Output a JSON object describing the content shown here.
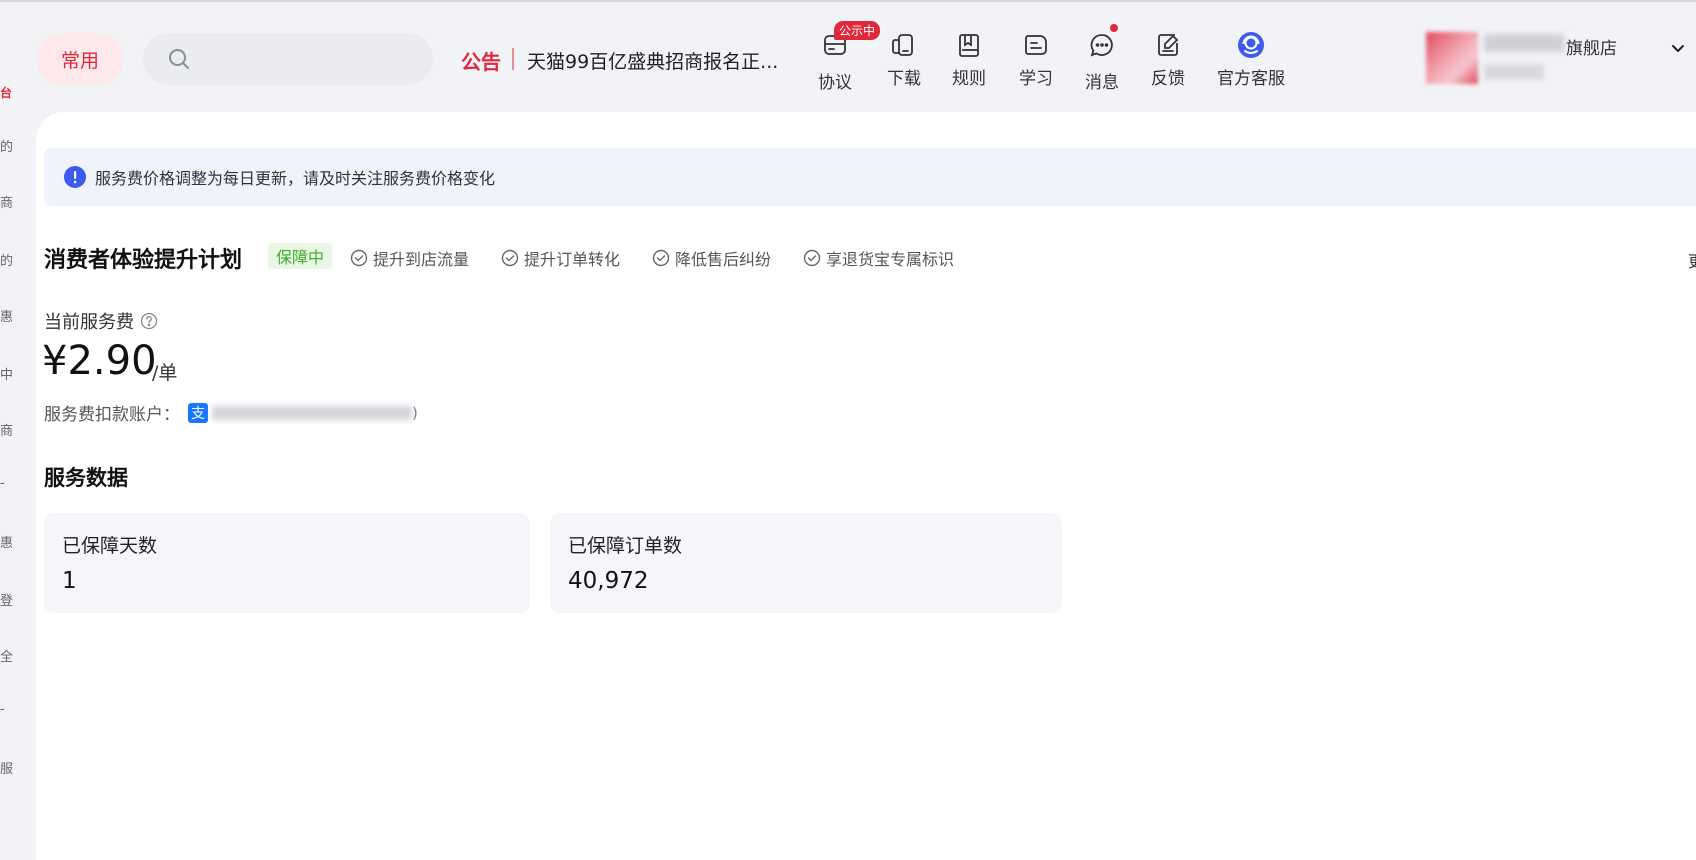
{
  "sidebar": {
    "fragments": [
      "台",
      "的",
      "商",
      "的",
      "惠",
      "中",
      "商",
      "-",
      "惠",
      "登",
      "全",
      "-",
      "服"
    ]
  },
  "header": {
    "common_label": "常用",
    "search": {
      "placeholder": ""
    },
    "notice": {
      "label": "公告",
      "text": "天猫99百亿盛典招商报名正..."
    },
    "nav": [
      {
        "label": "协议",
        "icon": "agreement-icon",
        "badge": "公示中"
      },
      {
        "label": "下载",
        "icon": "download-icon"
      },
      {
        "label": "规则",
        "icon": "rules-icon"
      },
      {
        "label": "学习",
        "icon": "learn-icon"
      },
      {
        "label": "消息",
        "icon": "message-icon",
        "has_dot": true
      },
      {
        "label": "反馈",
        "icon": "feedback-icon"
      },
      {
        "label": "官方客服",
        "icon": "customer-service-icon"
      }
    ],
    "shop": {
      "name_suffix": "旗舰店"
    }
  },
  "alert": {
    "text": "服务费价格调整为每日更新，请及时关注服务费价格变化"
  },
  "plan": {
    "title": "消费者体验提升计划",
    "status": "保障中",
    "benefits": [
      "提升到店流量",
      "提升订单转化",
      "降低售后纠纷",
      "享退货宝专属标识"
    ],
    "edge_char": "更"
  },
  "fee": {
    "label": "当前服务费",
    "value": "¥2.90",
    "unit": "/单",
    "account_label": "服务费扣款账户：",
    "alipay_glyph": "支",
    "account_close": ")"
  },
  "service_data": {
    "title": "服务数据",
    "stats": [
      {
        "label": "已保障天数",
        "value": "1"
      },
      {
        "label": "已保障订单数",
        "value": "40,972"
      }
    ]
  },
  "colors": {
    "brand_red": "#e0283c",
    "status_green": "#3fae2a",
    "info_blue": "#3d5af1",
    "alipay_blue": "#1677ff"
  }
}
